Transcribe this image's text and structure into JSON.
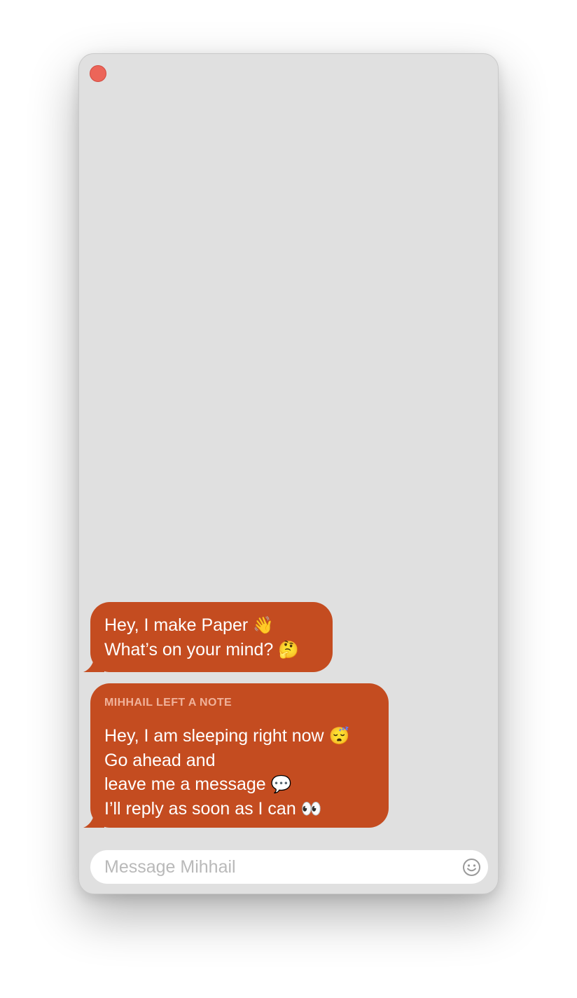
{
  "window": {
    "close_button": "close"
  },
  "messages": [
    {
      "lines": [
        {
          "text": "Hey, I make Paper",
          "emoji": "👋"
        },
        {
          "text": "What’s on your mind?",
          "emoji": "🤔"
        }
      ]
    },
    {
      "label": "MIHHAIL LEFT A NOTE",
      "lines": [
        {
          "text": "Hey, I am sleeping right now",
          "emoji": "😴"
        },
        {
          "text": "Go ahead and",
          "emoji": ""
        },
        {
          "text": "leave me a message",
          "emoji": "💬"
        },
        {
          "text": "I’ll reply as soon as I can",
          "emoji": "👀"
        }
      ]
    }
  ],
  "composer": {
    "placeholder": "Message Mihhail",
    "value": "",
    "emoji_button_icon": "smiley-icon"
  },
  "colors": {
    "bubble": "#c44c20",
    "note_label": "#f0b29a",
    "window_bg": "#e0e0e0",
    "close_button": "#ec6559"
  }
}
